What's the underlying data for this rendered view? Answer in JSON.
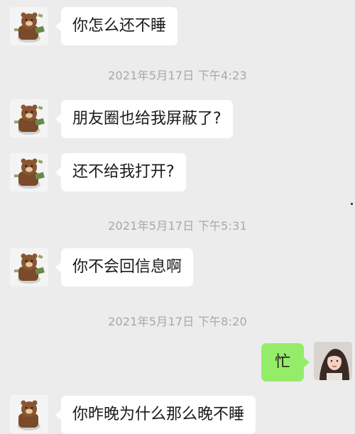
{
  "messages": [
    {
      "side": "left",
      "text": "你怎么还不睡"
    },
    {
      "type": "timestamp",
      "text": "2021年5月17日 下午4:23"
    },
    {
      "side": "left",
      "text": "朋友圈也给我屏蔽了?"
    },
    {
      "side": "left",
      "text": "还不给我打开?"
    },
    {
      "type": "timestamp",
      "text": "2021年5月17日 下午5:31"
    },
    {
      "side": "left",
      "text": "你不会回信息啊"
    },
    {
      "type": "timestamp",
      "text": "2021年5月17日 下午8:20"
    },
    {
      "side": "right",
      "text": "忙"
    },
    {
      "side": "left",
      "text": "你昨晚为什么那么晚不睡"
    }
  ],
  "colors": {
    "background": "#ececec",
    "incoming_bubble": "#ffffff",
    "outgoing_bubble": "#95ec69",
    "timestamp_text": "#a8a8a8"
  },
  "icons": {
    "contact_avatar": "brown-bear-avatar-icon",
    "self_avatar": "user-photo-avatar-icon"
  }
}
